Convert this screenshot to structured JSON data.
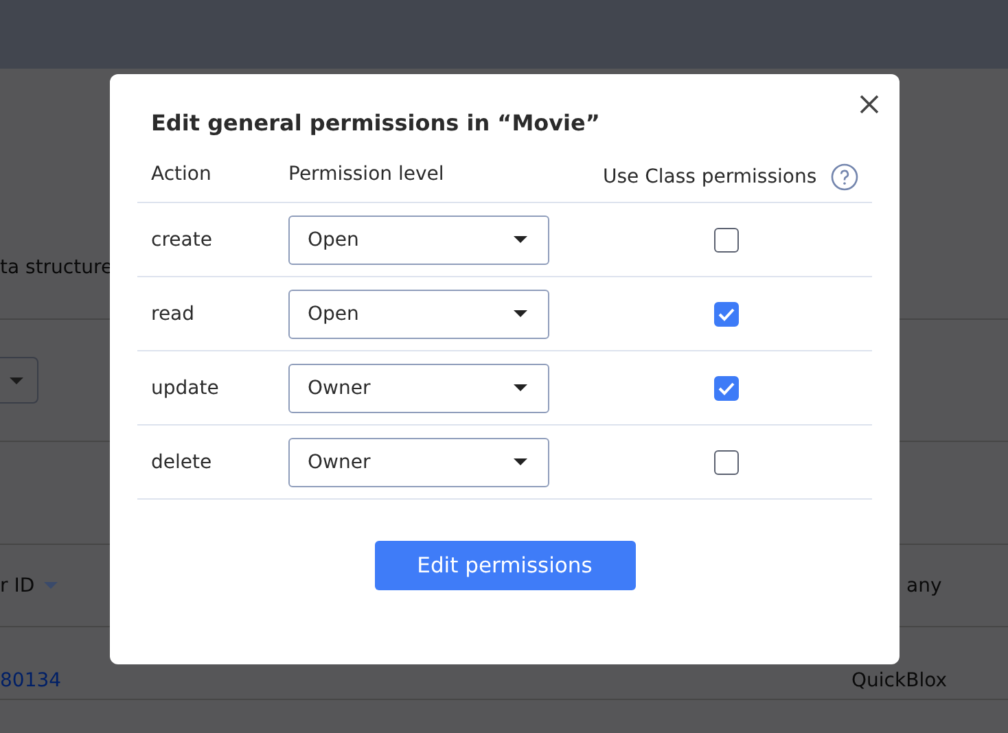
{
  "background": {
    "intro_text": "ta structure",
    "table": {
      "columns": [
        "r ID",
        "",
        "",
        "",
        "any"
      ],
      "rows": [
        {
          "cells": [
            "80134",
            "",
            "",
            "",
            "QuickBlox"
          ]
        }
      ]
    }
  },
  "dialog": {
    "title": "Edit general permissions in “Movie”",
    "columns": [
      "Action",
      "Permission level",
      "Use Class permissions"
    ],
    "rows": [
      {
        "action": "create",
        "level": "Open",
        "use_class": false
      },
      {
        "action": "read",
        "level": "Open",
        "use_class": true
      },
      {
        "action": "update",
        "level": "Owner",
        "use_class": true
      },
      {
        "action": "delete",
        "level": "Owner",
        "use_class": false
      }
    ],
    "submit": "Edit permissions"
  }
}
